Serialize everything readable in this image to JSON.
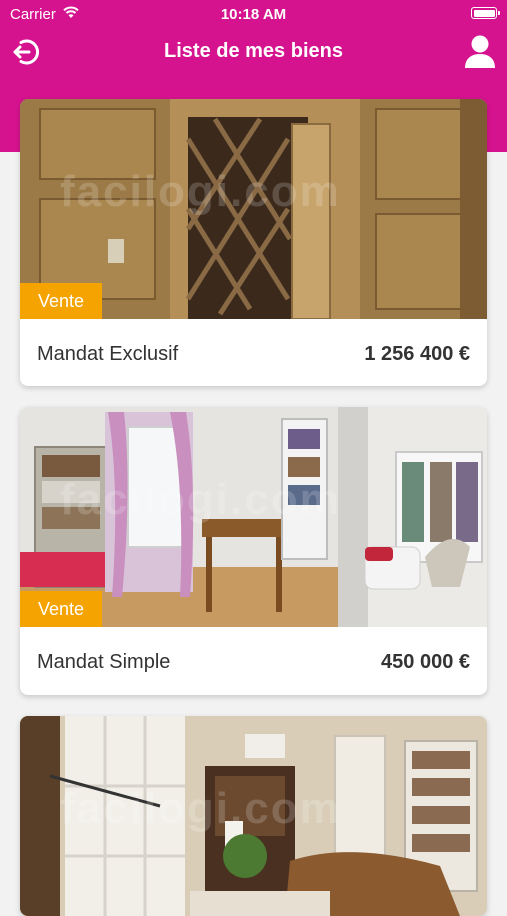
{
  "status_bar": {
    "carrier": "Carrier",
    "time": "10:18 AM"
  },
  "nav": {
    "title": "Liste de mes biens",
    "back_icon": "logout-circle-arrow-icon",
    "profile_icon": "user-icon"
  },
  "colors": {
    "brand": "#d6138f",
    "badge": "#f5a300",
    "background": "#f2f2f2"
  },
  "listings": [
    {
      "badge": "Vente",
      "title": "Mandat Exclusif",
      "price": "1 256 400 €",
      "watermark": "facilogi.com"
    },
    {
      "badge": "Vente",
      "title": "Mandat Simple",
      "price": "450 000 €",
      "watermark": "facilogi.com"
    },
    {
      "badge": "",
      "title": "",
      "price": "",
      "watermark": "facilogi.com"
    }
  ]
}
